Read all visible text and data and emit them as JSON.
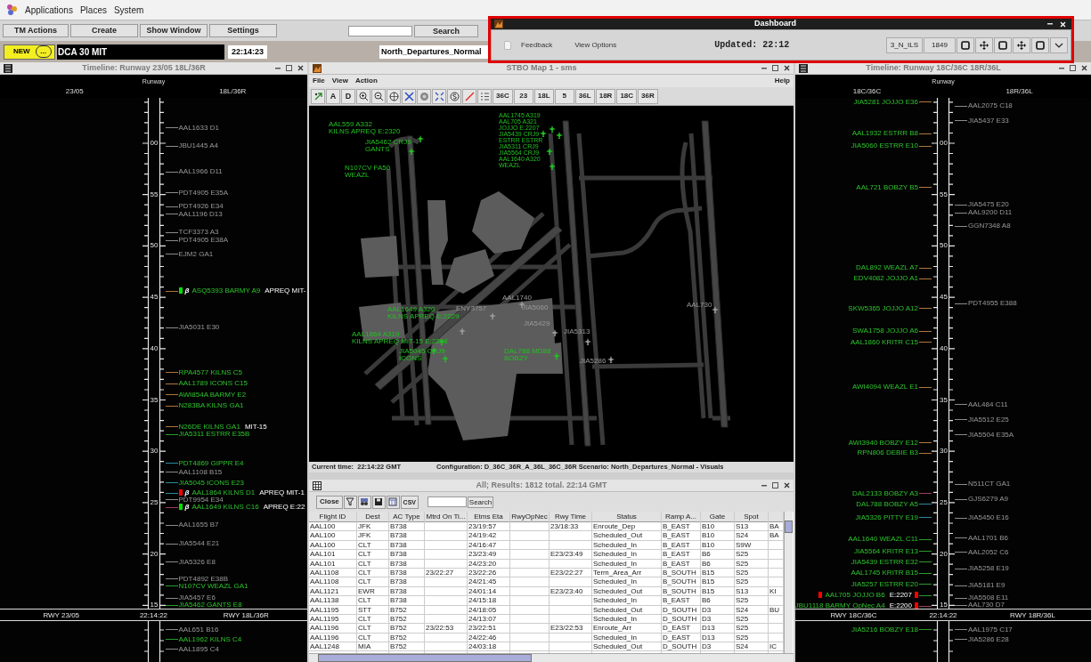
{
  "top_menu": [
    "Applications",
    "Places",
    "System"
  ],
  "toolbar": {
    "buttons": [
      "TM Actions",
      "Create",
      "Show Window",
      "Settings"
    ],
    "search_button": "Search"
  },
  "status_row": {
    "badge": "NEW",
    "more": "...",
    "message": "DCA 30 MIT",
    "clock": "22:14:23",
    "scenario": "North_Departures_Normal"
  },
  "dashboard": {
    "title": "Dashboard",
    "links": [
      "Feedback",
      "View Options"
    ],
    "updated": "Updated: 22:12",
    "buttons": [
      "3_N_ILS",
      "1849"
    ]
  },
  "timelines": [
    {
      "title": "Timeline: Runway 23/05 18L/36R",
      "heading": "Runway",
      "left_label": "23/05",
      "right_label": "18L/36R",
      "ticks": [
        "00",
        "55",
        "50",
        "45",
        "40",
        "35",
        "30",
        "25",
        "20",
        "15"
      ],
      "right_entries": [
        {
          "text": "AAL1633 D1",
          "level": 0.942,
          "color": "#8a8a8a",
          "active": false
        },
        {
          "text": "JBU1445 A4",
          "level": 0.906,
          "color": "#8a8a8a",
          "active": false
        },
        {
          "text": "AAL1966 D11",
          "level": 0.856,
          "color": "#8a8a8a",
          "active": false
        },
        {
          "text": "PDT4905 E35A",
          "level": 0.815,
          "color": "#8a8a8a",
          "active": false
        },
        {
          "text": "PDT4926 E34",
          "level": 0.788,
          "color": "#8a8a8a",
          "active": false
        },
        {
          "text": "AAL1196 D13",
          "level": 0.773,
          "color": "#8a8a8a",
          "active": false
        },
        {
          "text": "TCF3373 A3",
          "level": 0.737,
          "color": "#8a8a8a",
          "active": false
        },
        {
          "text": "PDT4905 E38A",
          "level": 0.722,
          "color": "#8a8a8a",
          "active": false
        },
        {
          "text": "EJM2 GA1",
          "level": 0.695,
          "color": "#8a8a8a",
          "active": false
        },
        {
          "text": "ASQ5393 BARMY A9",
          "level": 0.622,
          "color": "#b0763a",
          "active": true,
          "flag": {
            "color": "#00e000"
          },
          "symbol": "β",
          "note": "APREQ MIT-"
        },
        {
          "text": "JIA5031 E30",
          "level": 0.551,
          "color": "#8a8a8a",
          "active": false
        },
        {
          "text": "RPA4577 KILNS C5",
          "level": 0.463,
          "color": "#b0763a",
          "active": true
        },
        {
          "text": "AAL1789 ICONS C15",
          "level": 0.441,
          "color": "#b0763a",
          "active": true
        },
        {
          "text": "AWI854A BARMY E2",
          "level": 0.419,
          "color": "#b0763a",
          "active": true
        },
        {
          "text": "N283BA KILNS GA1",
          "level": 0.398,
          "color": "#b0763a",
          "active": true
        },
        {
          "text": "N26DE KILNS GA1",
          "level": 0.357,
          "color": "#b0763a",
          "active": true,
          "note": "MIT-15"
        },
        {
          "text": "JIA5311 ESTRR E35B",
          "level": 0.342,
          "color": "#2a9a2a",
          "active": true
        },
        {
          "text": "PDT4869 GIPPR E4",
          "level": 0.285,
          "color": "#2a8a9a",
          "active": true
        },
        {
          "text": "AAL1108 B15",
          "level": 0.268,
          "color": "#8a8a8a",
          "active": false
        },
        {
          "text": "JIA5045 ICONS E23",
          "level": 0.247,
          "color": "#2a8a9a",
          "active": true
        },
        {
          "text": "AAL1864 KILNS D1",
          "level": 0.227,
          "color": "#2a8a9a",
          "active": true,
          "flag": {
            "color": "#ff0000"
          },
          "symbol": "β",
          "note": "APREQ MIT-1"
        },
        {
          "text": "PDT9954 E34",
          "level": 0.214,
          "color": "#8a8a8a",
          "active": false
        },
        {
          "text": "AAL1649 KILNS C16",
          "level": 0.199,
          "color": "#a0405a",
          "active": true,
          "flag": {
            "color": "#00e000"
          },
          "symbol": "β",
          "note": "APREQ E:22"
        },
        {
          "text": "AAL1655 B7",
          "level": 0.164,
          "color": "#8a8a8a",
          "active": false
        },
        {
          "text": "JIA5544 E21",
          "level": 0.128,
          "color": "#8a8a8a",
          "active": false
        },
        {
          "text": "JIA5326 E8",
          "level": 0.092,
          "color": "#8a8a8a",
          "active": false
        },
        {
          "text": "PDT4892 E38B",
          "level": 0.059,
          "color": "#8a8a8a",
          "active": false
        },
        {
          "text": "N107CV WEAZL GA1",
          "level": 0.045,
          "color": "#2a9a2a",
          "active": true
        },
        {
          "text": "JIA5457 E6",
          "level": 0.021,
          "color": "#8a8a8a",
          "active": false
        },
        {
          "text": "JIA5462 GANTS E8",
          "level": 0.007,
          "color": "#2a9a2a",
          "active": true
        }
      ],
      "footer": {
        "left": "RWY 23/05",
        "time": "22:14:22",
        "right": "RWY 18L/36R"
      },
      "past_right": [
        {
          "text": "AAL651 B16",
          "color": "#8a8a8a",
          "active": false
        },
        {
          "text": "AAL1962 KILNS C4",
          "color": "#2a9a2a",
          "active": true
        },
        {
          "text": "AAL1895 C4",
          "color": "#8a8a8a",
          "active": false
        }
      ]
    },
    {
      "title": "Timeline: Runway 18C/36C 18R/36L",
      "heading": "Runway",
      "left_label": "18C/36C",
      "right_label": "18R/36L",
      "ticks": [
        "00",
        "55",
        "50",
        "45",
        "40",
        "35",
        "30",
        "25",
        "20",
        "15"
      ],
      "left_entries": [
        {
          "text": "JIA5281 JOJJO E36",
          "level": 0.993,
          "color": "#b0763a",
          "active": true
        },
        {
          "text": "AAL1932 ESTRR B8",
          "level": 0.931,
          "color": "#b0763a",
          "active": true
        },
        {
          "text": "JIA5060 ESTRR E10",
          "level": 0.906,
          "color": "#b0763a",
          "active": true
        },
        {
          "text": "AAL721 BOBZY B5",
          "level": 0.825,
          "color": "#b0763a",
          "active": true
        },
        {
          "text": "DAL892 WEAZL A7",
          "level": 0.668,
          "color": "#b0763a",
          "active": true
        },
        {
          "text": "EDV4082 JOJJO A1",
          "level": 0.647,
          "color": "#b0763a",
          "active": true
        },
        {
          "text": "SKW5365 JOJJO A12",
          "level": 0.588,
          "color": "#b0763a",
          "active": true
        },
        {
          "text": "SWA1758 JOJJO A6",
          "level": 0.544,
          "color": "#b0763a",
          "active": true
        },
        {
          "text": "AAL1860 KRITR C15",
          "level": 0.522,
          "color": "#b0763a",
          "active": true
        },
        {
          "text": "AWI4094 WEAZL E1",
          "level": 0.434,
          "color": "#b0763a",
          "active": true
        },
        {
          "text": "AWI3940 BOBZY E12",
          "level": 0.325,
          "color": "#b0763a",
          "active": true
        },
        {
          "text": "RPN806 DEBIE B3",
          "level": 0.305,
          "color": "#b0763a",
          "active": true
        },
        {
          "text": "DAL2133 BOBZY A3",
          "level": 0.226,
          "color": "#a0405a",
          "active": true
        },
        {
          "text": "DAL788 BOBZY A5",
          "level": 0.205,
          "color": "#2a8a9a",
          "active": true
        },
        {
          "text": "JIA5326 PITTY E19",
          "level": 0.179,
          "color": "#2a8a9a",
          "active": true
        },
        {
          "text": "AAL1640 WEAZL C11",
          "level": 0.136,
          "color": "#2a9a2a",
          "active": true
        },
        {
          "text": "JIA5564 KRITR E13",
          "level": 0.113,
          "color": "#2a9a2a",
          "active": true
        },
        {
          "text": "JIA5439 ESTRR E32",
          "level": 0.092,
          "color": "#2a9a2a",
          "active": true
        },
        {
          "text": "AAL1745 KRITR B15",
          "level": 0.07,
          "color": "#2a9a2a",
          "active": true
        },
        {
          "text": "JIA5257 ESTRR E20",
          "level": 0.048,
          "color": "#2a9a2a",
          "active": true
        },
        {
          "text": "AAL705 JOJJO B6",
          "level": 0.027,
          "color": "#2a9a2a",
          "active": true,
          "flag": {
            "color": "#ff0000"
          },
          "note": "E:2207",
          "end_flag": {
            "color": "#ff0000"
          }
        },
        {
          "text": "JBU1118 BARMY OpNec A4",
          "level": 0.006,
          "color": "#a0405a",
          "active": true,
          "note": "E:2200",
          "end_flag": {
            "color": "#ff0000"
          }
        }
      ],
      "right_entries": [
        {
          "text": "AAL2075 C18",
          "level": 0.985,
          "color": "#8a8a8a",
          "active": false
        },
        {
          "text": "JIA5437 E33",
          "level": 0.956,
          "color": "#8a8a8a",
          "active": false
        },
        {
          "text": "JIA5475 E20",
          "level": 0.791,
          "color": "#8a8a8a",
          "active": false
        },
        {
          "text": "AAL9200 D11",
          "level": 0.776,
          "color": "#8a8a8a",
          "active": false
        },
        {
          "text": "GGN7348 A8",
          "level": 0.75,
          "color": "#8a8a8a",
          "active": false
        },
        {
          "text": "PDT4955 E388",
          "level": 0.598,
          "color": "#8a8a8a",
          "active": false
        },
        {
          "text": "AAL484 C11",
          "level": 0.4,
          "color": "#8a8a8a",
          "active": false
        },
        {
          "text": "JIA5512 E25",
          "level": 0.371,
          "color": "#8a8a8a",
          "active": false
        },
        {
          "text": "JIA5504 E35A",
          "level": 0.341,
          "color": "#8a8a8a",
          "active": false
        },
        {
          "text": "N511CT GA1",
          "level": 0.244,
          "color": "#8a8a8a",
          "active": false
        },
        {
          "text": "GJS6279 A9",
          "level": 0.215,
          "color": "#8a8a8a",
          "active": false
        },
        {
          "text": "JIA5450 E16",
          "level": 0.178,
          "color": "#8a8a8a",
          "active": false
        },
        {
          "text": "AAL1701 B6",
          "level": 0.139,
          "color": "#8a8a8a",
          "active": false
        },
        {
          "text": "AAL2052 C6",
          "level": 0.111,
          "color": "#8a8a8a",
          "active": false
        },
        {
          "text": "JIA5258 E19",
          "level": 0.079,
          "color": "#8a8a8a",
          "active": false
        },
        {
          "text": "JIA5181 E9",
          "level": 0.046,
          "color": "#8a8a8a",
          "active": false
        },
        {
          "text": "JIA5508 E11",
          "level": 0.021,
          "color": "#8a8a8a",
          "active": false
        },
        {
          "text": "AAL730 D7",
          "level": 0.007,
          "color": "#8a8a8a",
          "active": false
        }
      ],
      "footer": {
        "left": "RWY 18C/36C",
        "time": "22:14:22",
        "right": "RWY 18R/36L"
      },
      "past_left": [
        {
          "text": "JIA5216 BOBZY E18",
          "color": "#2a9a2a",
          "active": true
        }
      ],
      "past_right": [
        {
          "text": "AAL1975 C17",
          "color": "#8a8a8a",
          "active": false
        },
        {
          "text": "JIA5286 E28",
          "color": "#8a8a8a",
          "active": false
        }
      ]
    }
  ],
  "map": {
    "title": "STBO Map 1 - sms",
    "menu": [
      "File",
      "View",
      "Action"
    ],
    "help": "Help",
    "letter_tools": [
      "A",
      "D"
    ],
    "runway_buttons": [
      "36C",
      "23",
      "18L",
      "5",
      "36L",
      "18R",
      "18C",
      "36R"
    ],
    "labels": [
      {
        "lines": [
          "AAL1745 A319",
          "AAL705 A321",
          "JOJJO E:2207",
          "JIA5439 CRJ9",
          "ESTRR ESTRR",
          "JIA5311 CRJ9",
          "JIA5564 CRJ9",
          "AAL1640 A320",
          "WEAZL"
        ],
        "active": true
      },
      {
        "lines": [
          "AAL559 A332",
          "KILNS APREQ E:2320"
        ],
        "active": true
      },
      {
        "lines": [
          "JIA5462 CRJ9",
          "GANTS"
        ],
        "active": true
      },
      {
        "lines": [
          "N107CV FA50",
          "WEAZL"
        ],
        "active": true
      },
      {
        "lines": [
          "AAL1740"
        ],
        "active": false
      },
      {
        "lines": [
          "AAL730"
        ],
        "active": false
      },
      {
        "lines": [
          "ENY3757"
        ],
        "active": false
      },
      {
        "lines": [
          "JIA5060"
        ],
        "active": false
      },
      {
        "lines": [
          "AAL1649 A320",
          "KILNS APREQ E:2229"
        ],
        "active": true
      },
      {
        "lines": [
          "JIA5429"
        ],
        "active": false
      },
      {
        "lines": [
          "JIA5313"
        ],
        "active": false
      },
      {
        "lines": [
          "AAL1864 A319",
          "KILNS APREQ MIT-15 E:2208"
        ],
        "active": true
      },
      {
        "lines": [
          "JIA5045 CRJ9",
          "ICONS"
        ],
        "active": true
      },
      {
        "lines": [
          "DAL788 MD88",
          "BOBZY"
        ],
        "active": true
      },
      {
        "lines": [
          "JIA5286"
        ],
        "active": false
      }
    ],
    "current_time": "Current time:  22:14:22 GMT",
    "configuration": "Configuration: D_36C_36R_A_36L_36C_36R Scenario: North_Departures_Normal - Visuals"
  },
  "results": {
    "title": "All; Results: 1812 total. 22:14 GMT",
    "close": "Close",
    "export_label": "CSV",
    "search_button": "Search",
    "columns": [
      "Flight ID",
      "Dest",
      "AC Type",
      "Mtrd On Ti...",
      "Etms Eta",
      "RwyOpNec",
      "Rwy Time",
      "Status",
      "Ramp A...",
      "Gate",
      "Spot"
    ],
    "rows": [
      [
        "AAL100",
        "JFK",
        "B738",
        null,
        "23/19:57",
        null,
        "23/18:33",
        "Enroute_Dep",
        "B_EAST",
        "B10",
        "S13",
        "BA"
      ],
      [
        "AAL100",
        "JFK",
        "B738",
        null,
        "24/19:42",
        null,
        null,
        "Scheduled_Out",
        "B_EAST",
        "B10",
        "S24",
        "BA"
      ],
      [
        "AAL100",
        "CLT",
        "B738",
        null,
        "24/16:47",
        null,
        null,
        "Scheduled_In",
        "B_EAST",
        "B10",
        "S9W",
        null
      ],
      [
        "AAL101",
        "CLT",
        "B738",
        null,
        "23/23:49",
        null,
        "E23/23:49",
        "Scheduled_In",
        "B_EAST",
        "B6",
        "S25",
        null
      ],
      [
        "AAL101",
        "CLT",
        "B738",
        null,
        "24/23:20",
        null,
        null,
        "Scheduled_In",
        "B_EAST",
        "B6",
        "S25",
        null
      ],
      [
        "AAL1108",
        "CLT",
        "B738",
        "23/22:27",
        "23/22:26",
        null,
        "E23/22:27",
        "Term_Area_Arr",
        "B_SOUTH",
        "B15",
        "S25",
        null
      ],
      [
        "AAL1108",
        "CLT",
        "B738",
        null,
        "24/21:45",
        null,
        null,
        "Scheduled_In",
        "B_SOUTH",
        "B15",
        "S25",
        null
      ],
      [
        "AAL1121",
        "EWR",
        "B738",
        null,
        "24/01:14",
        null,
        "E23/23:40",
        "Scheduled_Out",
        "B_SOUTH",
        "B15",
        "S13",
        "KI"
      ],
      [
        "AAL1138",
        "CLT",
        "B738",
        null,
        "24/15:18",
        null,
        null,
        "Scheduled_In",
        "B_EAST",
        "B6",
        "S25",
        null
      ],
      [
        "AAL1195",
        "STT",
        "B752",
        null,
        "24/18:05",
        null,
        null,
        "Scheduled_Out",
        "D_SOUTH",
        "D3",
        "S24",
        "BU"
      ],
      [
        "AAL1195",
        "CLT",
        "B752",
        null,
        "24/13:07",
        null,
        null,
        "Scheduled_In",
        "D_SOUTH",
        "D3",
        "S25",
        null
      ],
      [
        "AAL1196",
        "CLT",
        "B752",
        "23/22:53",
        "23/22:51",
        null,
        "E23/22:53",
        "Enroute_Arr",
        "D_EAST",
        "D13",
        "S25",
        null
      ],
      [
        "AAL1196",
        "CLT",
        "B752",
        null,
        "24/22:46",
        null,
        null,
        "Scheduled_In",
        "D_EAST",
        "D13",
        "S25",
        null
      ],
      [
        "AAL1248",
        "MIA",
        "B752",
        null,
        "24/03:18",
        null,
        null,
        "Scheduled_Out",
        "D_SOUTH",
        "D3",
        "S24",
        "IC"
      ]
    ]
  }
}
